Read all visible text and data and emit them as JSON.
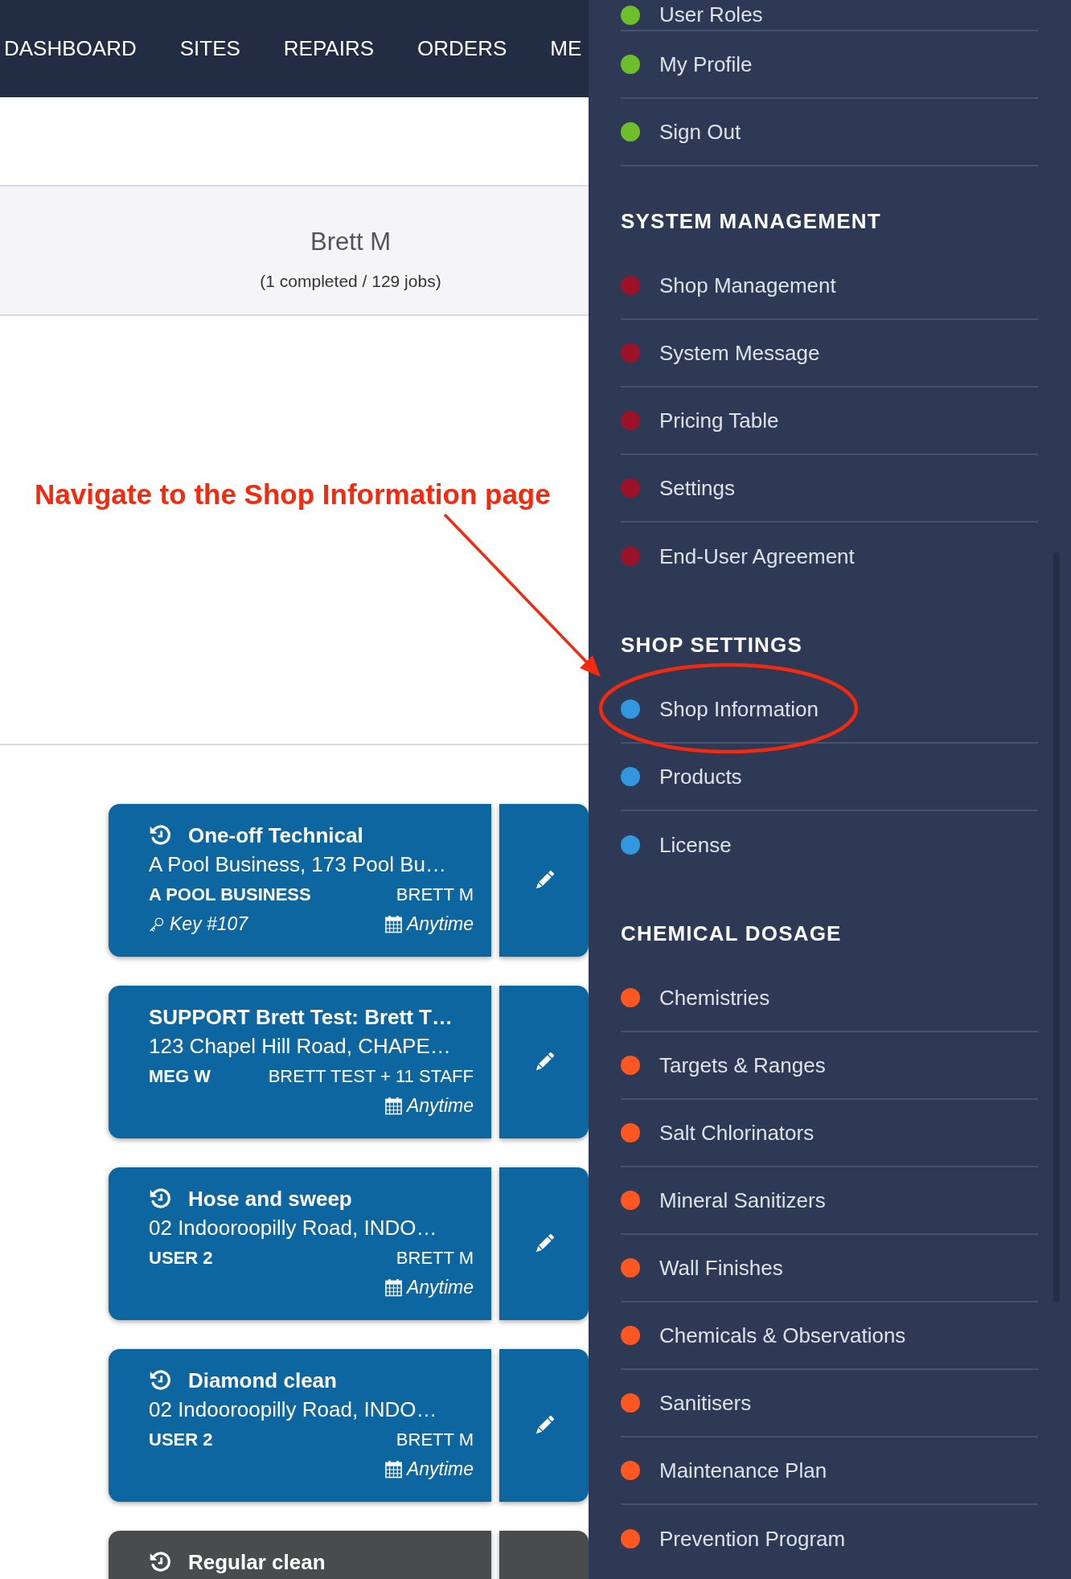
{
  "nav": [
    "DASHBOARD",
    "SITES",
    "REPAIRS",
    "ORDERS",
    "ME"
  ],
  "summary": {
    "name": "Brett M",
    "jobs_text": "(1 completed / 129 jobs)"
  },
  "annotation": {
    "text": "Navigate to the Shop Information page"
  },
  "jobs": [
    {
      "history_icon": true,
      "title": "One-off Technical",
      "address": "A Pool Business, 173 Pool Bu…",
      "client": "A POOL BUSINESS",
      "staff": "BRETT M",
      "key": "Key #107",
      "schedule": "Anytime",
      "color": "#0e66a1"
    },
    {
      "history_icon": false,
      "title": "SUPPORT Brett Test: Brett T…",
      "address": "123 Chapel Hill Road, CHAPE…",
      "client": "MEG W",
      "staff": "BRETT TEST + 11 STAFF",
      "schedule": "Anytime",
      "color": "#0e66a1"
    },
    {
      "history_icon": true,
      "title": "Hose and sweep",
      "address": "02 Indooroopilly Road, INDO…",
      "client": "USER 2",
      "staff": "BRETT M",
      "schedule": "Anytime",
      "color": "#0e66a1"
    },
    {
      "history_icon": true,
      "title": "Diamond clean",
      "address": "02 Indooroopilly Road, INDO…",
      "client": "USER 2",
      "staff": "BRETT M",
      "schedule": "Anytime",
      "color": "#0e66a1"
    },
    {
      "history_icon": true,
      "title": "Regular clean",
      "color": "#4a4b4d"
    }
  ],
  "sidebar": {
    "groups": [
      {
        "items": [
          {
            "label": "User Roles",
            "color": "#6fbf2c"
          },
          {
            "label": "My Profile",
            "color": "#6fbf2c"
          },
          {
            "label": "Sign Out",
            "color": "#6fbf2c"
          }
        ]
      },
      {
        "heading": "SYSTEM MANAGEMENT",
        "items": [
          {
            "label": "Shop Management",
            "color": "#9b1229"
          },
          {
            "label": "System Message",
            "color": "#9b1229"
          },
          {
            "label": "Pricing Table",
            "color": "#9b1229"
          },
          {
            "label": "Settings",
            "color": "#9b1229"
          },
          {
            "label": "End-User Agreement",
            "color": "#9b1229"
          }
        ]
      },
      {
        "heading": "SHOP SETTINGS",
        "items": [
          {
            "label": "Shop Information",
            "color": "#3297dc"
          },
          {
            "label": "Products",
            "color": "#3297dc"
          },
          {
            "label": "License",
            "color": "#3297dc"
          }
        ]
      },
      {
        "heading": "CHEMICAL DOSAGE",
        "items": [
          {
            "label": "Chemistries",
            "color": "#fe5722"
          },
          {
            "label": "Targets & Ranges",
            "color": "#fe5722"
          },
          {
            "label": "Salt Chlorinators",
            "color": "#fe5722"
          },
          {
            "label": "Mineral Sanitizers",
            "color": "#fe5722"
          },
          {
            "label": "Wall Finishes",
            "color": "#fe5722"
          },
          {
            "label": "Chemicals & Observations",
            "color": "#fe5722"
          },
          {
            "label": "Sanitisers",
            "color": "#fe5722"
          },
          {
            "label": "Maintenance Plan",
            "color": "#fe5722"
          },
          {
            "label": "Prevention Program",
            "color": "#fe5722"
          }
        ]
      }
    ]
  }
}
